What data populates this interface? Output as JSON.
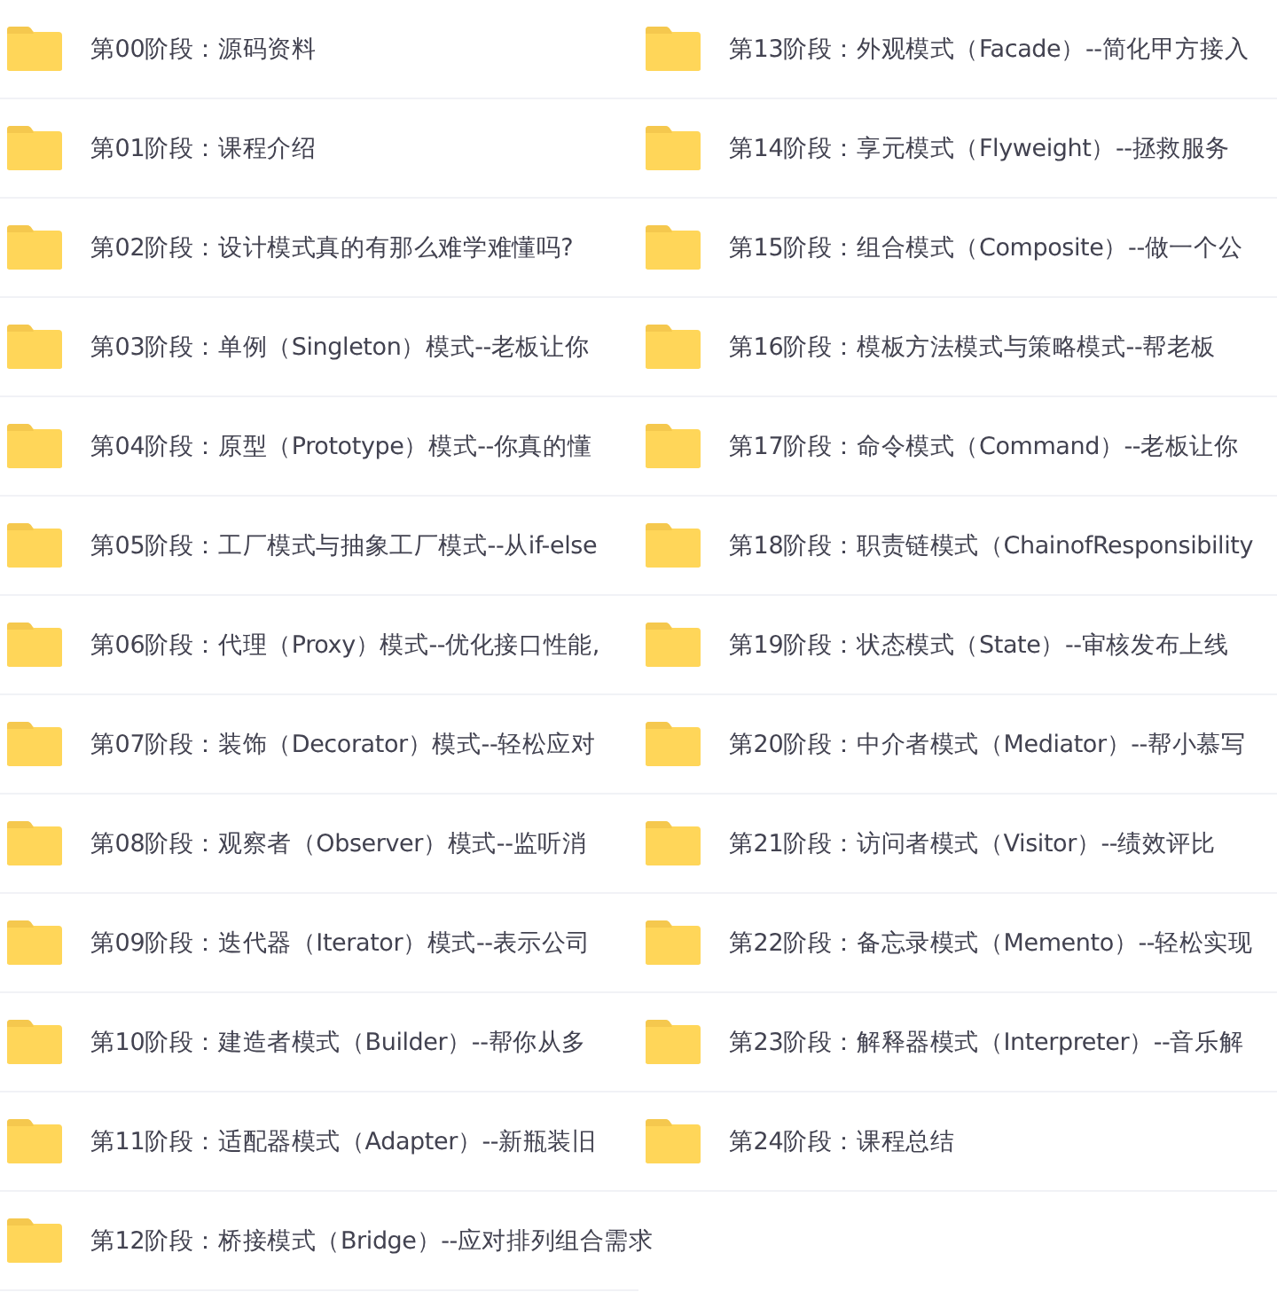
{
  "columns": [
    {
      "folders": [
        {
          "name": "第00阶段：源码资料"
        },
        {
          "name": "第01阶段：课程介绍"
        },
        {
          "name": "第02阶段：设计模式真的有那么难学难懂吗?"
        },
        {
          "name": "第03阶段：单例（Singleton）模式--老板让你"
        },
        {
          "name": "第04阶段：原型（Prototype）模式--你真的懂"
        },
        {
          "name": "第05阶段：工厂模式与抽象工厂模式--从if-else"
        },
        {
          "name": "第06阶段：代理（Proxy）模式--优化接口性能,"
        },
        {
          "name": "第07阶段：装饰（Decorator）模式--轻松应对"
        },
        {
          "name": "第08阶段：观察者（Observer）模式--监听消"
        },
        {
          "name": "第09阶段：迭代器（Iterator）模式--表示公司"
        },
        {
          "name": "第10阶段：建造者模式（Builder）--帮你从多"
        },
        {
          "name": "第11阶段：适配器模式（Adapter）--新瓶装旧"
        },
        {
          "name": "第12阶段：桥接模式（Bridge）--应对排列组合需求"
        }
      ]
    },
    {
      "folders": [
        {
          "name": "第13阶段：外观模式（Facade）--简化甲方接入"
        },
        {
          "name": "第14阶段：享元模式（Flyweight）--拯救服务"
        },
        {
          "name": "第15阶段：组合模式（Composite）--做一个公"
        },
        {
          "name": "第16阶段：模板方法模式与策略模式--帮老板"
        },
        {
          "name": "第17阶段：命令模式（Command）--老板让你"
        },
        {
          "name": "第18阶段：职责链模式（ChainofResponsibility"
        },
        {
          "name": "第19阶段：状态模式（State）--审核发布上线"
        },
        {
          "name": "第20阶段：中介者模式（Mediator）--帮小慕写"
        },
        {
          "name": "第21阶段：访问者模式（Visitor）--绩效评比"
        },
        {
          "name": "第22阶段：备忘录模式（Memento）--轻松实现"
        },
        {
          "name": "第23阶段：解释器模式（Interpreter）--音乐解"
        },
        {
          "name": "第24阶段：课程总结"
        }
      ]
    }
  ]
}
